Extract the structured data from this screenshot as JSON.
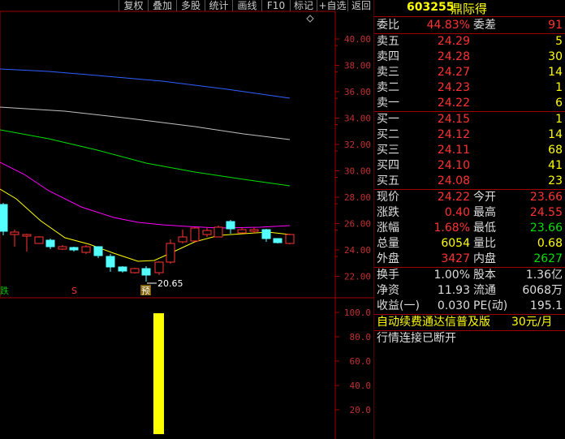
{
  "toolbar": {
    "buttons": [
      "复权",
      "叠加",
      "多股",
      "统计",
      "画线",
      "F10",
      "标记",
      "+自选",
      "返回"
    ]
  },
  "stock": {
    "code": "603255",
    "name": "鼎际得"
  },
  "price_axis": [
    "40.00",
    "38.00",
    "36.00",
    "34.00",
    "32.00",
    "30.00",
    "28.00",
    "26.00",
    "24.00",
    "22.00"
  ],
  "low_marker": "20.65",
  "event_markers": [
    "跌",
    "S",
    "预"
  ],
  "volume_axis": [
    "100.0",
    "80.0",
    "60.0",
    "40.0",
    "20.0"
  ],
  "diamond_icon": "diamond-icon",
  "quote": {
    "weibi_label": "委比",
    "weibi_value": "44.83%",
    "weicha_label": "委差",
    "weicha_value": "91",
    "asks": [
      {
        "label": "卖五",
        "price": "24.29",
        "vol": "5"
      },
      {
        "label": "卖四",
        "price": "24.28",
        "vol": "30"
      },
      {
        "label": "卖三",
        "price": "24.27",
        "vol": "14"
      },
      {
        "label": "卖二",
        "price": "24.23",
        "vol": "1"
      },
      {
        "label": "卖一",
        "price": "24.22",
        "vol": "6"
      }
    ],
    "bids": [
      {
        "label": "买一",
        "price": "24.15",
        "vol": "1"
      },
      {
        "label": "买二",
        "price": "24.12",
        "vol": "14"
      },
      {
        "label": "买三",
        "price": "24.11",
        "vol": "68"
      },
      {
        "label": "买四",
        "price": "24.10",
        "vol": "41"
      },
      {
        "label": "买五",
        "price": "24.08",
        "vol": "23"
      }
    ],
    "stats": [
      {
        "l1": "现价",
        "v1": "24.22",
        "l2": "今开",
        "v2": "23.66"
      },
      {
        "l1": "涨跌",
        "v1": "0.40",
        "l2": "最高",
        "v2": "24.55"
      },
      {
        "l1": "涨幅",
        "v1": "1.68%",
        "l2": "最低",
        "v2": "23.66"
      },
      {
        "l1": "总量",
        "v1": "6054",
        "l2": "量比",
        "v2": "0.68"
      },
      {
        "l1": "外盘",
        "v1": "3427",
        "l2": "内盘",
        "v2": "2627"
      }
    ],
    "stats2": [
      {
        "l1": "换手",
        "v1": "1.00%",
        "l2": "股本",
        "v2": "1.36亿"
      },
      {
        "l1": "净资",
        "v1": "11.93",
        "l2": "流通",
        "v2": "6068万"
      },
      {
        "l1": "收益(一)",
        "v1": "0.030",
        "l2": "PE(动)",
        "v2": "195.1"
      }
    ],
    "ad_text": "自动续费通达信普及版",
    "ad_price": "30元/月",
    "status_text": "行情连接已断开"
  },
  "colors": {
    "up": "#ff3232",
    "down": "#54ffff",
    "ma_white": "#ffffff",
    "ma_yellow": "#ffff00",
    "ma_magenta": "#ff00ff",
    "ma_green": "#00e000",
    "ma_gray": "#c0c0c0",
    "ma_blue": "#3060ff",
    "volume_bar": "#ffff00"
  }
}
